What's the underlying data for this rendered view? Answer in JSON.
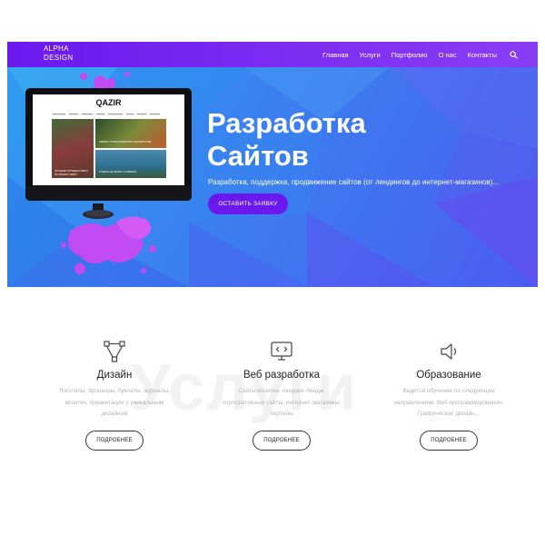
{
  "nav": {
    "logo_line1": "ALPHA",
    "logo_line2": "DESIGN",
    "items": [
      "Главная",
      "Услуги",
      "Портфолио",
      "О нас",
      "Контакты"
    ],
    "search_icon": "search-icon"
  },
  "hero": {
    "title_line1": "Разработка",
    "title_line2": "Сайтов",
    "subtitle": "Разработка, поддержка, продвижение сайтов (от лендингов до интернет-магазинов)...",
    "cta": "ОСТАВИТЬ ЗАЯВКУ",
    "mock": {
      "logo": "QAZIR",
      "captions": [
        "ЛУЧШИЕ ПУТЕШЕСТВИЯ ПО ВСЕМУ МИРУ",
        "ОБЗОР ТУРИСТИЧЕСКИХ МАРШРУТОВ",
        "ОТДЫХ НА МОРЕ И ОЗЕРАХ"
      ]
    }
  },
  "services": {
    "watermark": "Услуги",
    "items": [
      {
        "icon": "vector-pen-icon",
        "title": "Дизайн",
        "desc_line1": "Логотипы, брошюры, буклеты, журналы,",
        "desc_line2": "визитки, презентации с уникальным",
        "desc_line3": "дизайном",
        "button": "ПОДРОБНЕЕ"
      },
      {
        "icon": "code-monitor-icon",
        "title": "Веб разработка",
        "desc_line1": "Сайты-визитки, лендинг-пейдж,",
        "desc_line2": "корпоративные сайты, интернет-магазины,",
        "desc_line3": "порталы",
        "button": "ПОДРОБНЕЕ"
      },
      {
        "icon": "speaker-icon",
        "title": "Образование",
        "desc_line1": "Ведется обучение по следующим",
        "desc_line2": "направлениям: Веб-программирование,",
        "desc_line3": "Графический дизайн...",
        "button": "ПОДРОБНЕЕ"
      }
    ]
  },
  "colors": {
    "nav_purple": "#6a18ee",
    "hero_blue": "#3b7ff0",
    "paint_splash": "#c04bf0",
    "cta": "#6a18ee"
  }
}
